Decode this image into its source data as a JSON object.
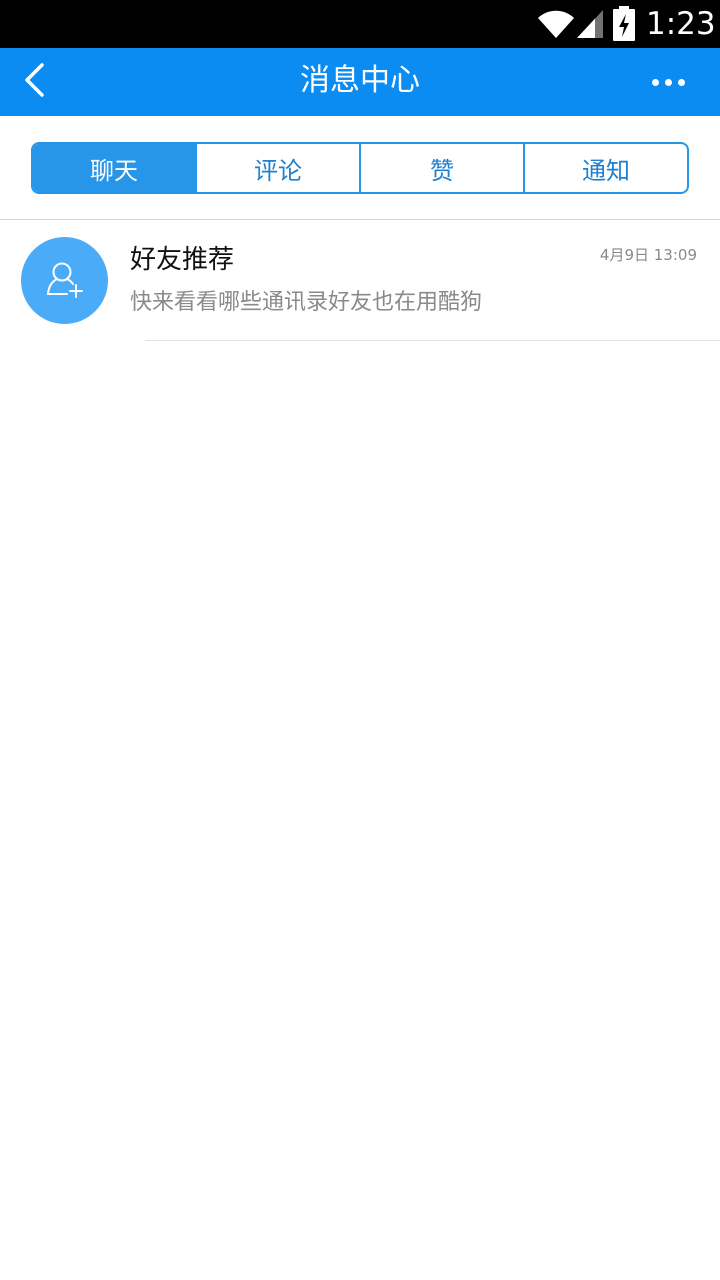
{
  "status_bar": {
    "time": "1:23",
    "icons": [
      "wifi-icon",
      "signal-icon",
      "battery-charging-icon"
    ]
  },
  "app_bar": {
    "title": "消息中心",
    "back_icon": "chevron-left-icon",
    "more_icon": "more-dots-icon"
  },
  "tabs": [
    {
      "label": "聊天",
      "active": true
    },
    {
      "label": "评论",
      "active": false
    },
    {
      "label": "赞",
      "active": false
    },
    {
      "label": "通知",
      "active": false
    }
  ],
  "messages": [
    {
      "title": "好友推荐",
      "subtitle": "快来看看哪些通讯录好友也在用酷狗",
      "time": "4月9日 13:09",
      "avatar_icon": "add-user-icon"
    }
  ],
  "colors": {
    "app_bar": "#0a8cf3",
    "tab_active": "#2796e8",
    "avatar": "#4aabf8"
  }
}
